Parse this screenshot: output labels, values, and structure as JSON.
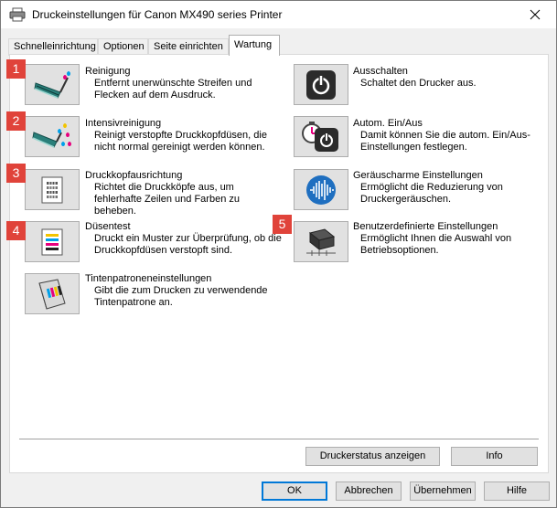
{
  "window": {
    "title": "Druckeinstellungen für Canon MX490 series Printer"
  },
  "tabs": [
    {
      "label": "Schnelleinrichtung"
    },
    {
      "label": "Optionen"
    },
    {
      "label": "Seite einrichten"
    },
    {
      "label": "Wartung"
    }
  ],
  "active_tab": "Wartung",
  "left_items": [
    {
      "title": "Reinigung",
      "desc": "Entfernt unerwünschte Streifen und Flecken auf dem Ausdruck.",
      "badge": "1",
      "icon": "cleaning-brush-icon"
    },
    {
      "title": "Intensivreinigung",
      "desc": "Reinigt verstopfte Druckkopfdüsen, die nicht normal gereinigt werden können.",
      "badge": "2",
      "icon": "deep-cleaning-brush-icon"
    },
    {
      "title": "Druckkopfausrichtung",
      "desc": "Richtet die Druckköpfe aus, um fehlerhafte Zeilen und Farben zu beheben.",
      "badge": "3",
      "icon": "alignment-page-icon"
    },
    {
      "title": "Düsentest",
      "desc": "Druckt ein Muster zur Überprüfung, ob die Druckkopfdüsen verstopft sind.",
      "badge": "4",
      "icon": "nozzle-check-page-icon"
    },
    {
      "title": "Tintenpatroneneinstellungen",
      "desc": "Gibt die zum Drucken zu verwendende Tintenpatrone an.",
      "badge": "",
      "icon": "ink-cartridge-icon"
    }
  ],
  "right_items": [
    {
      "title": "Ausschalten",
      "desc": "Schaltet den Drucker aus.",
      "badge": "",
      "icon": "power-icon"
    },
    {
      "title": "Autom. Ein/Aus",
      "desc": "Damit können Sie die autom. Ein/Aus-Einstellungen festlegen.",
      "badge": "",
      "icon": "auto-power-timer-icon"
    },
    {
      "title": "Geräuscharme Einstellungen",
      "desc": "Ermöglicht die Reduzierung von Druckergeräuschen.",
      "badge": "",
      "icon": "quiet-mode-icon"
    },
    {
      "title": "Benutzerdefinierte Einstellungen",
      "desc": "Ermöglicht Ihnen die Auswahl von Betriebsoptionen.",
      "badge": "5",
      "icon": "custom-settings-printer-icon"
    }
  ],
  "panel_buttons": {
    "status": "Druckerstatus anzeigen",
    "info": "Info"
  },
  "dialog_buttons": {
    "ok": "OK",
    "cancel": "Abbrechen",
    "apply": "Übernehmen",
    "help": "Hilfe"
  },
  "colors": {
    "badge": "#e0433a",
    "power_button": "#2b2b2b",
    "quiet_mode": "#1f6fc0",
    "focus": "#0078d7"
  }
}
